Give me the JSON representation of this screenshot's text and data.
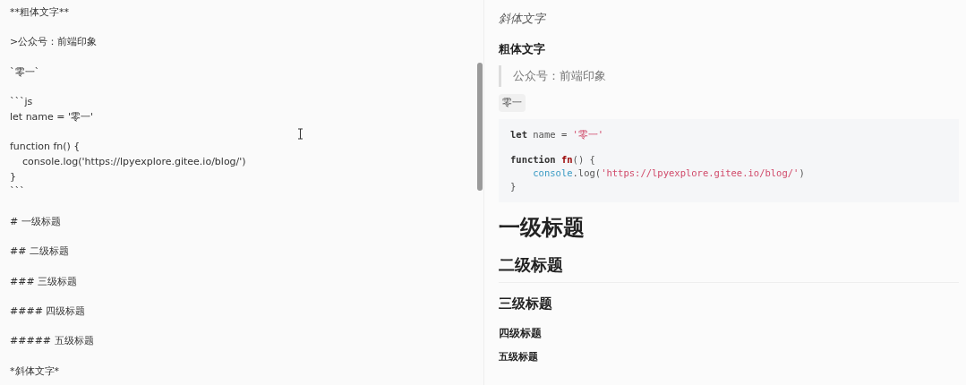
{
  "editor": {
    "blocks": [
      [
        "**粗体文字**"
      ],
      [
        ">公众号：前端印象"
      ],
      [
        "`零一`"
      ],
      [
        "```js",
        "let name = '零一'"
      ],
      [
        "function fn() {",
        "    console.log('https://lpyexplore.gitee.io/blog/')",
        "}",
        "```"
      ],
      [
        "# 一级标题"
      ],
      [
        "## 二级标题"
      ],
      [
        "### 三级标题"
      ],
      [
        "#### 四级标题"
      ],
      [
        "##### 五级标题"
      ],
      [
        "*斜体文字*"
      ]
    ]
  },
  "preview": {
    "items": [
      {
        "kind": "italic",
        "text": "斜体文字"
      },
      {
        "kind": "bold",
        "text": "粗体文字"
      },
      {
        "kind": "quote",
        "text": "公众号：前端印象"
      },
      {
        "kind": "inline_code",
        "text": "零一"
      },
      {
        "kind": "code",
        "groups": [
          [
            [
              {
                "text": "let",
                "kind": "keyword"
              },
              {
                "text": " name = ",
                "kind": "plain"
              },
              {
                "text": "'零一'",
                "kind": "string"
              }
            ]
          ],
          [
            [
              {
                "text": "function ",
                "kind": "keyword"
              },
              {
                "text": "fn",
                "kind": "func"
              },
              {
                "text": "() {",
                "kind": "plain"
              }
            ],
            [
              {
                "text": "    console",
                "kind": "builtin"
              },
              {
                "text": ".log(",
                "kind": "plain"
              },
              {
                "text": "'https://lpyexplore.gitee.io/blog/'",
                "kind": "string"
              },
              {
                "text": ")",
                "kind": "plain"
              }
            ],
            [
              {
                "text": "}",
                "kind": "plain"
              }
            ]
          ]
        ]
      },
      {
        "kind": "h1",
        "text": "一级标题"
      },
      {
        "kind": "h2",
        "text": "二级标题"
      },
      {
        "kind": "h3",
        "text": "三级标题"
      },
      {
        "kind": "h4",
        "text": "四级标题"
      },
      {
        "kind": "h5",
        "text": "五级标题"
      }
    ]
  }
}
